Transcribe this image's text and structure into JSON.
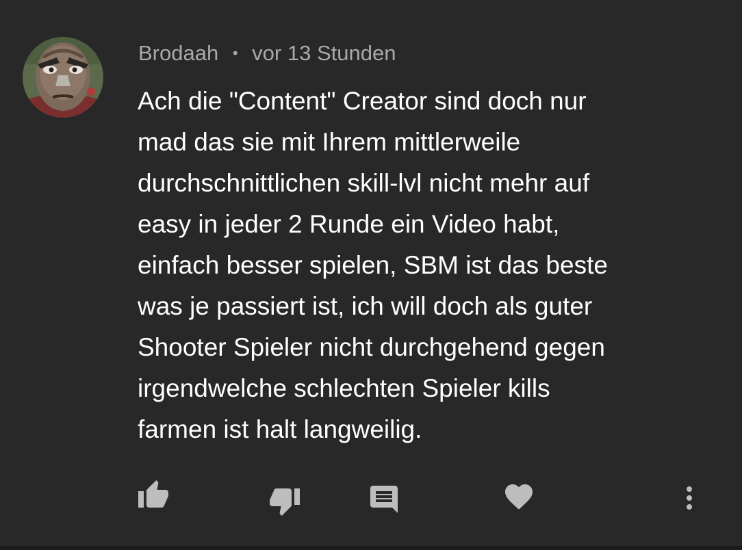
{
  "comment": {
    "author": "Brodaah",
    "separator": "•",
    "timestamp": "vor 13 Stunden",
    "body_lines": [
      "Ach die \"Content\" Creator sind doch nur",
      "mad das sie mit Ihrem mittlerweile",
      "durchschnittlichen skill-lvl nicht mehr auf",
      "easy in jeder 2 Runde ein Video habt,",
      "einfach besser spielen, SBM ist das beste",
      "was je passiert ist, ich will doch als guter",
      "Shooter Spieler nicht durchgehend gegen",
      "irgendwelche schlechten Spieler kills",
      "farmen ist halt langweilig."
    ]
  },
  "actions": [
    {
      "icon": "thumbs-up-icon"
    },
    {
      "icon": "thumbs-down-icon"
    },
    {
      "icon": "reply-comment-icon"
    },
    {
      "icon": "heart-icon"
    },
    {
      "icon": "more-vert-icon"
    }
  ],
  "colors": {
    "background": "#282828",
    "meta_text": "#a9a9a9",
    "body_text": "#ffffff",
    "icon": "#bdbdbd"
  }
}
